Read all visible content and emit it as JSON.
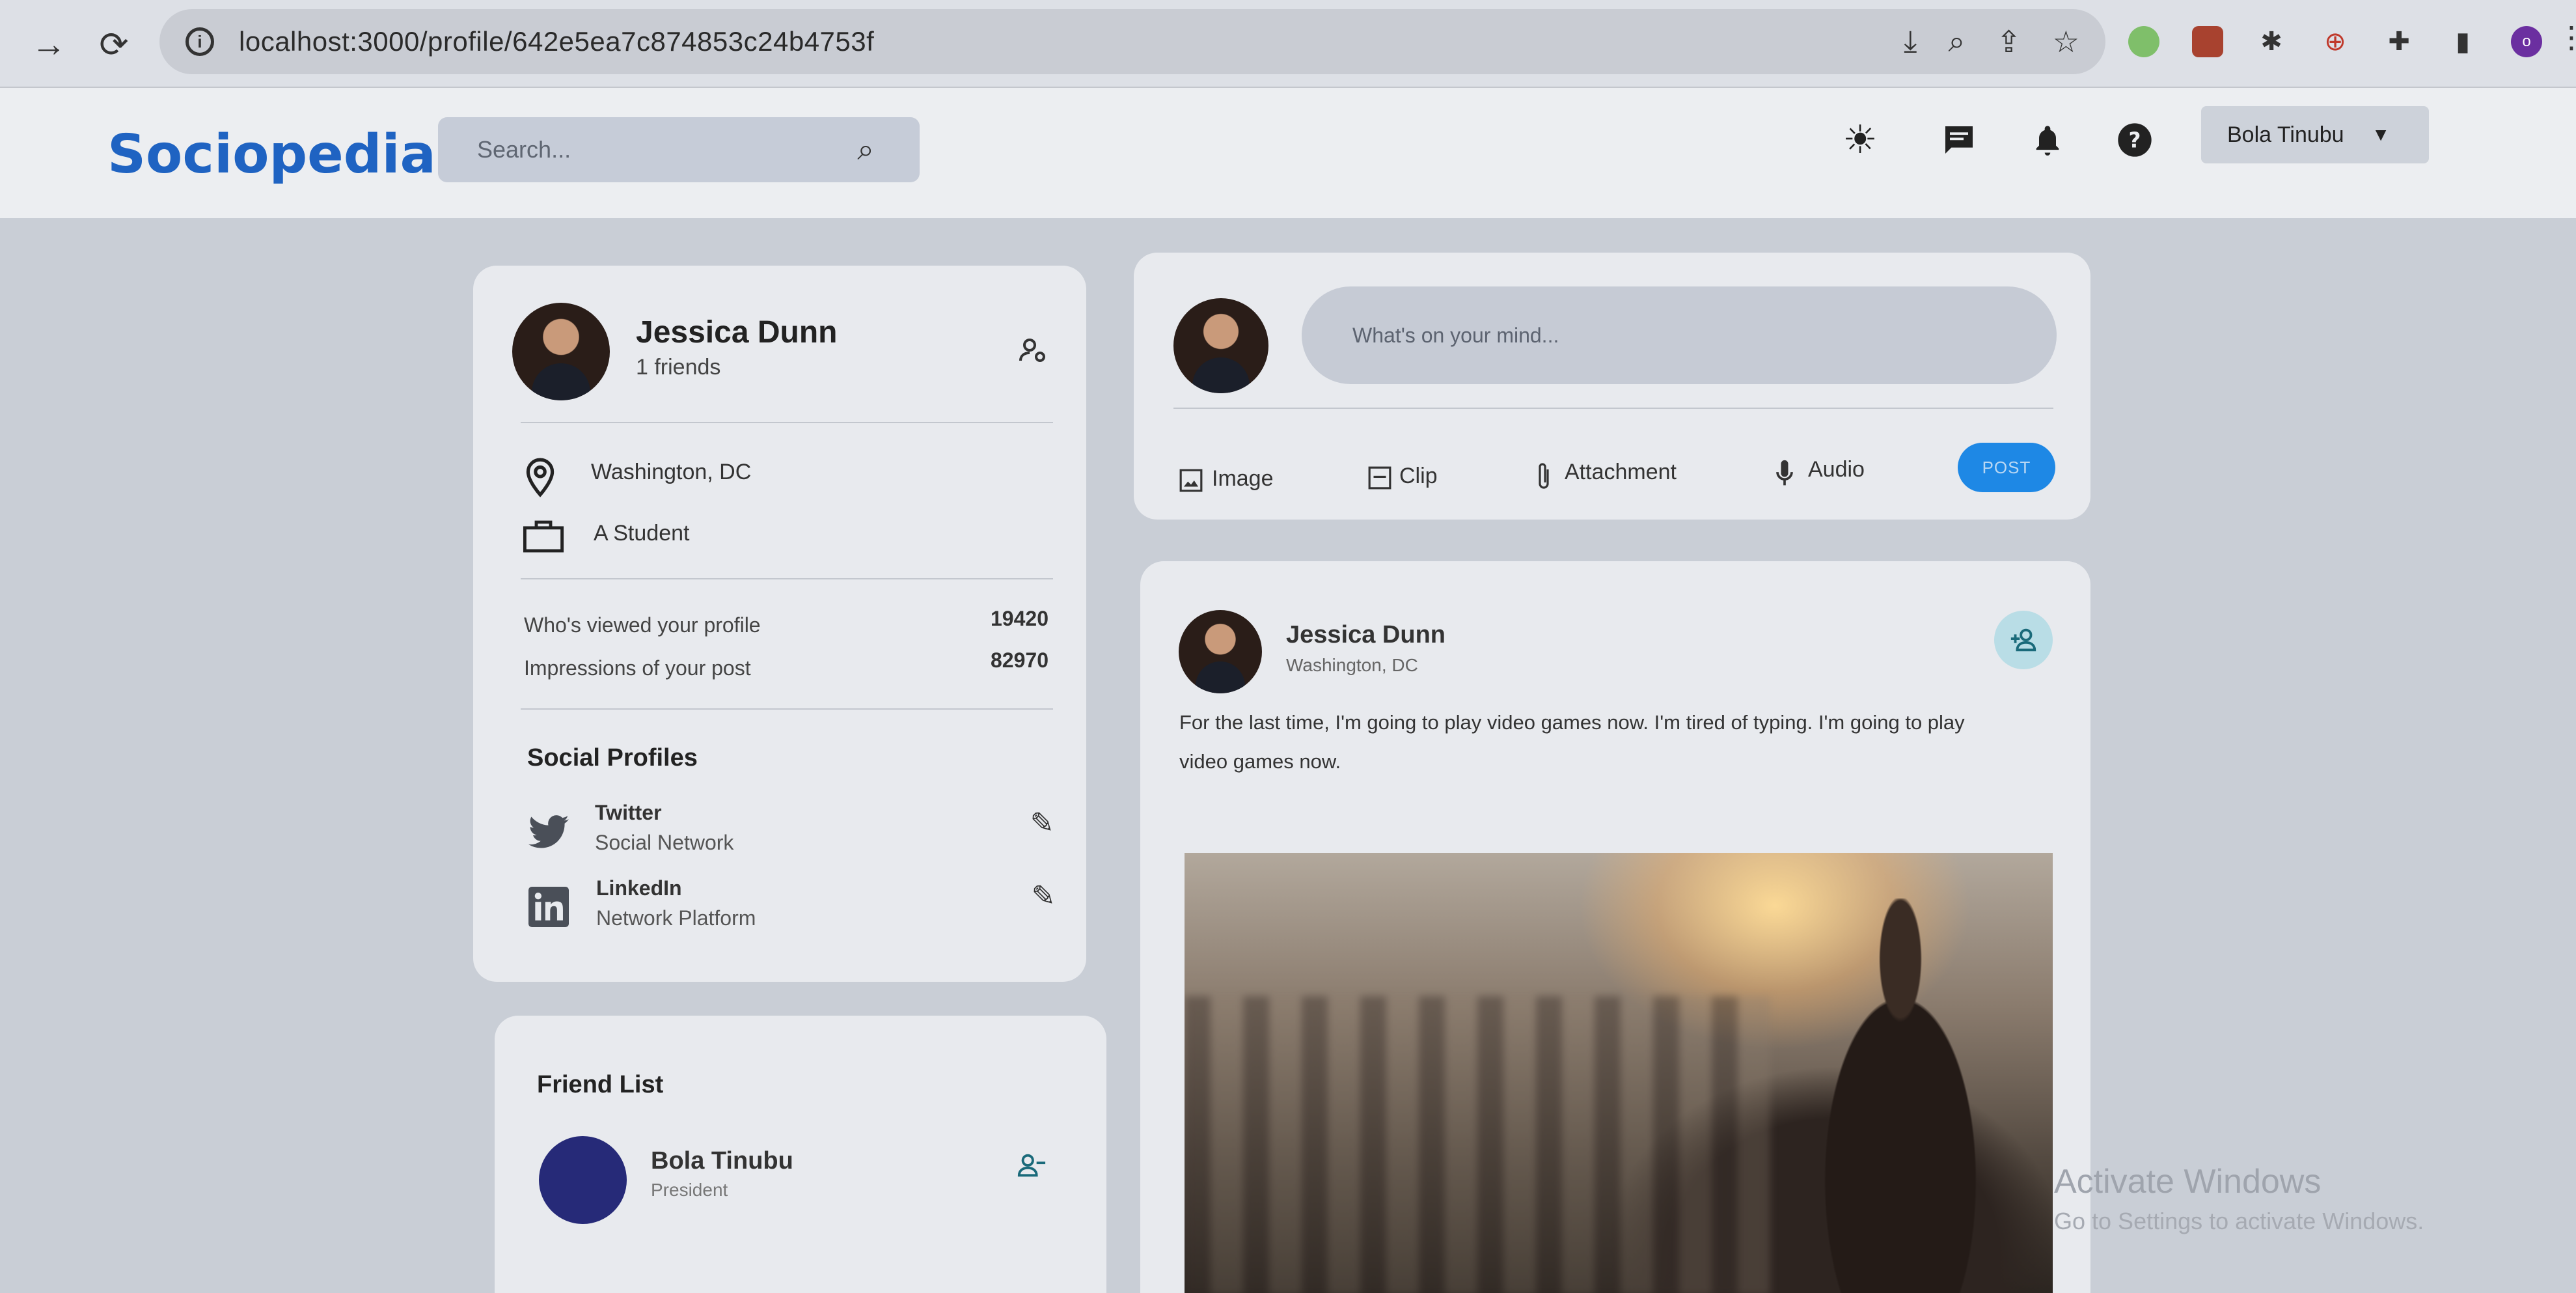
{
  "browser": {
    "url": "localhost:3000/profile/642e5ea7c874853c24b4753f",
    "profile_initial": "o"
  },
  "app": {
    "logo": "Sociopedia",
    "search_placeholder": "Search...",
    "user_select": "Bola Tinubu"
  },
  "user_card": {
    "name": "Jessica Dunn",
    "friends": "1 friends",
    "location": "Washington, DC",
    "occupation": "A Student",
    "viewed_label": "Who's viewed your profile",
    "viewed_value": "19420",
    "impressions_label": "Impressions of your post",
    "impressions_value": "82970",
    "social_title": "Social Profiles",
    "socials": [
      {
        "name": "Twitter",
        "sub": "Social Network"
      },
      {
        "name": "LinkedIn",
        "sub": "Network Platform"
      }
    ]
  },
  "friend_list": {
    "title": "Friend List",
    "friends": [
      {
        "name": "Bola Tinubu",
        "sub": "President"
      }
    ]
  },
  "composer": {
    "placeholder": "What's on your mind...",
    "actions": [
      "Image",
      "Clip",
      "Attachment",
      "Audio"
    ],
    "post_label": "POST"
  },
  "post": {
    "author": "Jessica Dunn",
    "location": "Washington, DC",
    "text_line1": "For the last time, I'm going to play video games now. I'm tired of typing. I'm going to play",
    "text_line2": "video games now."
  },
  "watermark": {
    "line1": "Activate Windows",
    "line2": "Go to Settings to activate Windows."
  },
  "colors": {
    "brand": "#1f63c2",
    "post_button": "#1e88e5",
    "page_bg": "#c9ced6",
    "card_bg": "#e8eaee"
  }
}
